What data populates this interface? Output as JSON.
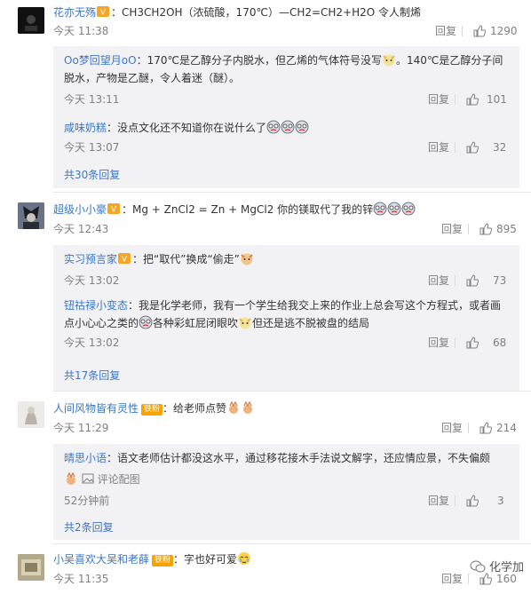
{
  "comments": [
    {
      "user": "花亦无殇",
      "text": "：CH3CH2OH（浓硫酸，170℃）—CH2=CH2+H2O 令人制烯",
      "time": "今天 11:38",
      "reply": "回复",
      "likes": "1290",
      "subs": [
        {
          "user": "Oo梦回望月oO",
          "text1": "：170℃是乙醇分子内脱水，但乙烯的气体符号没写",
          "text1b": "。140℃是乙醇分子间",
          "text2": "脱水，产物是乙醚，令人着迷（醚）。",
          "time": "今天 13:11",
          "reply": "回复",
          "likes": "101"
        },
        {
          "user": "咸味奶糕",
          "text1": "：没点文化还不知道你在说什么了",
          "time": "今天 13:07",
          "reply": "回复",
          "likes": "32"
        }
      ],
      "more": "共30条回复"
    },
    {
      "user": "超级小小豪",
      "text": "：Mg + ZnCl2 = Zn + MgCl2 你的镁取代了我的锌",
      "time": "今天 12:43",
      "reply": "回复",
      "likes": "895",
      "subs": [
        {
          "user": "实习预言家",
          "text1": "：把“取代”换成“偷走”",
          "time": "今天 13:02",
          "reply": "回复",
          "likes": "73"
        },
        {
          "user": "钮祜禄小变态",
          "text1": "：我是化学老师，我有一个学生给我交上来的作业上总会写这个方程式，或者画",
          "text2a": "点小心心之类的",
          "text2b": "各种彩虹屁闭眼吹",
          "text2c": "但还是逃不脱被盘的结局",
          "time": "今天 13:02",
          "reply": "回复",
          "likes": "68"
        }
      ],
      "more": "共17条回复"
    },
    {
      "user": "人间风物皆有灵性",
      "badge": "铁粉",
      "text": "：给老师点赞",
      "time": "今天 11:29",
      "reply": "回复",
      "likes": "214",
      "subs": [
        {
          "user": "晴思小语",
          "text1": "：语文老师估计都没这水平，通过移花接木手法说文解字，还应情应景，不失偏颇",
          "pic": "评论配图",
          "time": "52分钟前",
          "reply": "回复",
          "likes": "3"
        }
      ],
      "more": "共2条回复"
    },
    {
      "user": "小吴喜欢大吴和老薛",
      "badge": "铁粉",
      "text": "：字也好可爱",
      "time": "今天 11:35",
      "reply": "回复",
      "likes": "160"
    }
  ],
  "watermark": "化学加",
  "colors": {
    "username": "#eb7350",
    "link": "#3b76c5",
    "meta": "#808080",
    "subbg": "#f2f2f5"
  }
}
